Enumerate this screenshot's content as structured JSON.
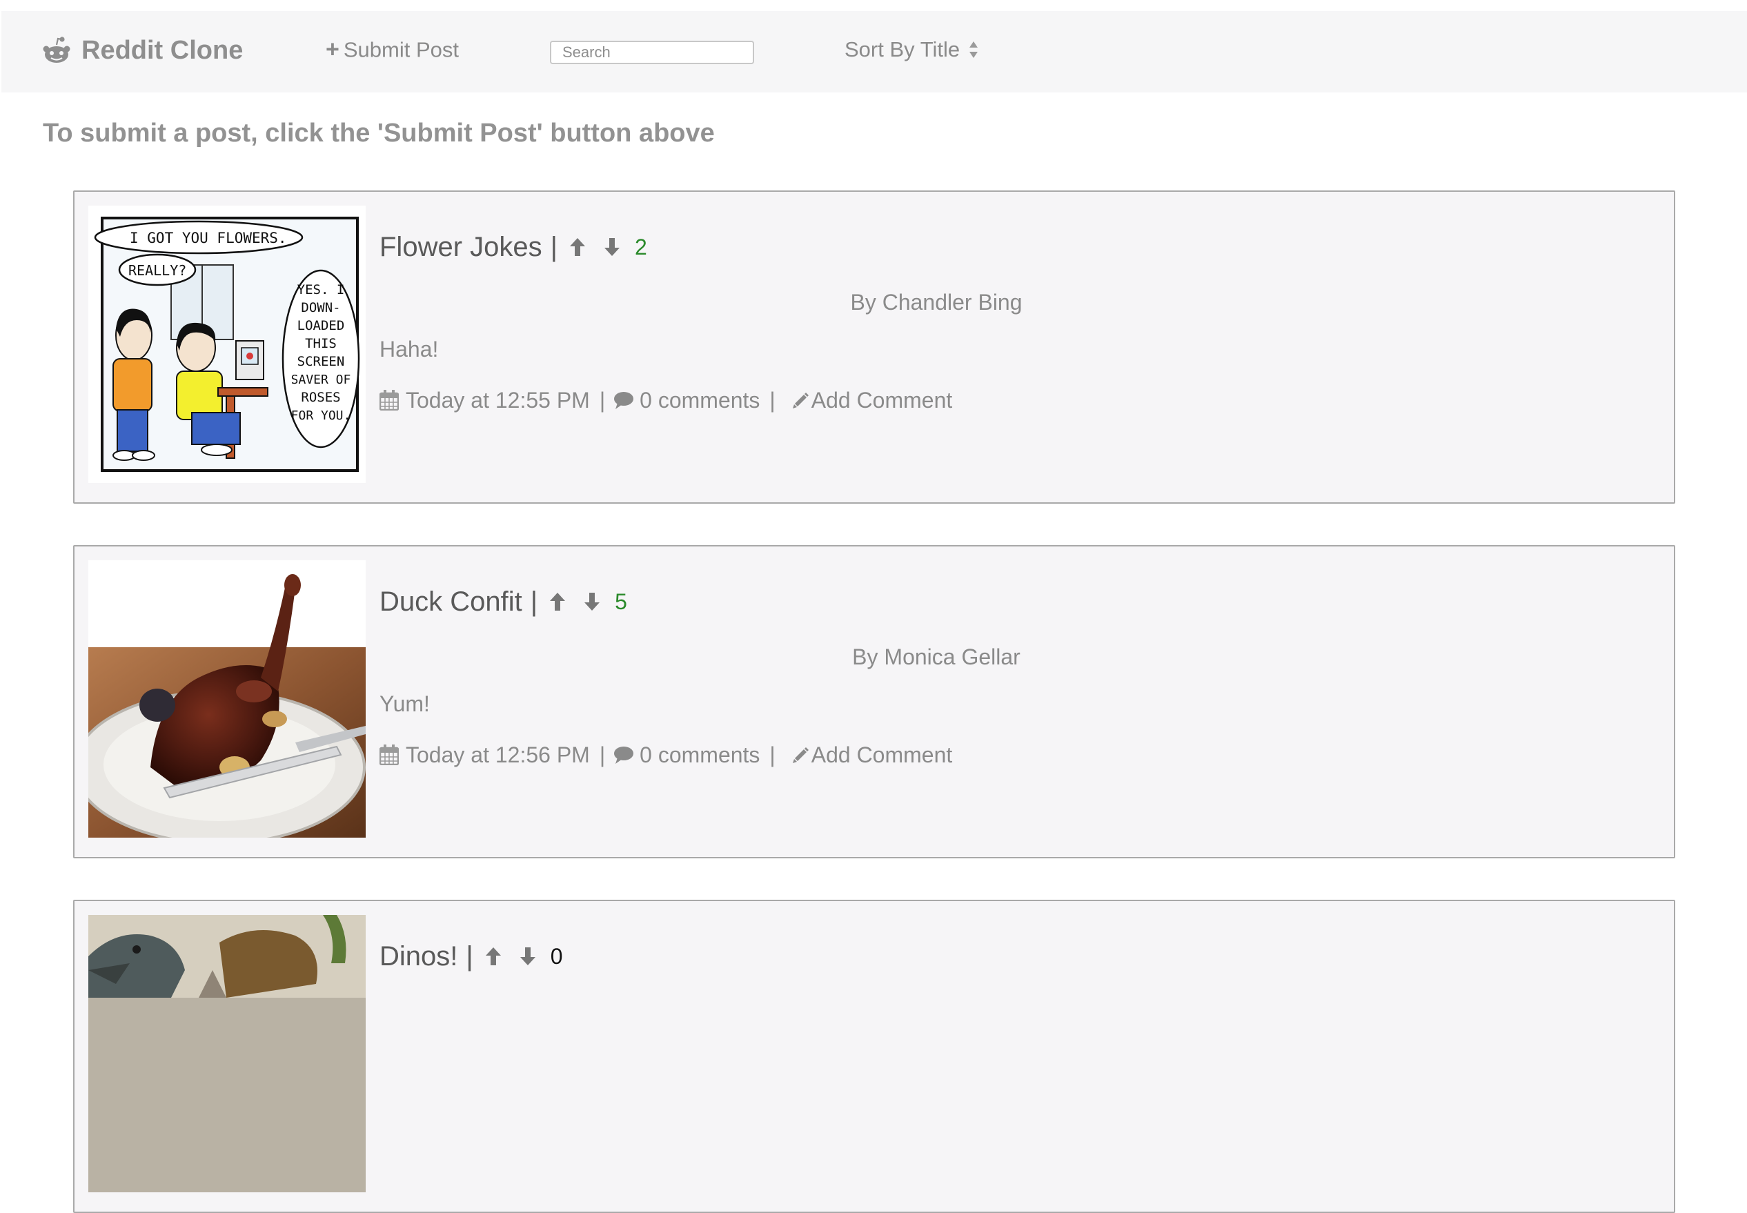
{
  "nav": {
    "brand": "Reddit Clone",
    "brand_icon": "reddit-alien-icon",
    "submit_label": "Submit Post",
    "submit_icon": "plus-icon",
    "search_placeholder": "Search",
    "sort_label": "Sort By Title",
    "sort_icon": "sort-arrows-icon"
  },
  "instruction": "To submit a post, click the 'Submit Post' button above",
  "colors": {
    "navbar_bg": "#f6f6f7",
    "card_bg": "#f6f5f7",
    "card_border": "#a9a9a9",
    "muted_text": "#8a8a8a",
    "title_text": "#595959",
    "positive_score": "#2b8a2b"
  },
  "posts": [
    {
      "title": "Flower Jokes",
      "separator": "|",
      "score": "2",
      "author": "By Chandler Bing",
      "body": "Haha!",
      "timestamp": "Today at 12:55 PM",
      "comments": "0 comments",
      "add_comment": "Add Comment",
      "image_speech": [
        "I GOT YOU FLOWERS.",
        "REALLY?",
        "YES. I",
        "DOWN-",
        "LOADED",
        "THIS",
        "SCREEN",
        "SAVER OF",
        "ROSES",
        "FOR YOU."
      ]
    },
    {
      "title": "Duck Confit",
      "separator": "|",
      "score": "5",
      "author": "By Monica Gellar",
      "body": "Yum!",
      "timestamp": "Today at 12:56 PM",
      "comments": "0 comments",
      "add_comment": "Add Comment"
    },
    {
      "title": "Dinos!",
      "separator": "|",
      "score": "0"
    }
  ],
  "meta_separator": "|"
}
